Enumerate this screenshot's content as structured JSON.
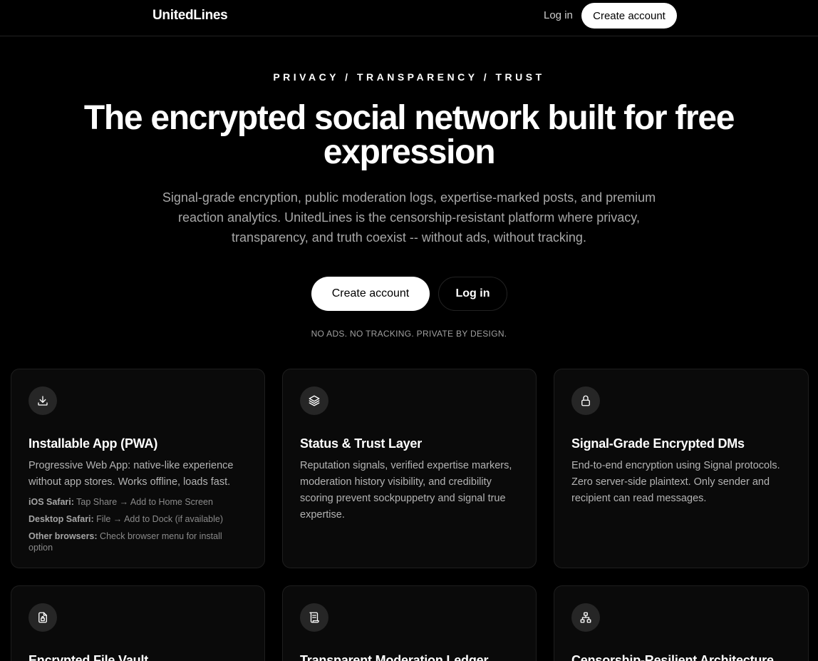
{
  "nav": {
    "brand": "UnitedLines",
    "login_label": "Log in",
    "create_label": "Create account"
  },
  "hero": {
    "eyebrow": "PRIVACY / TRANSPARENCY / TRUST",
    "title": "The encrypted social network built for free expression",
    "subtitle": "Signal-grade encryption, public moderation logs, expertise-marked posts, and premium reaction analytics. UnitedLines is the censorship-resistant platform where privacy, transparency, and truth coexist -- without ads, without tracking.",
    "create_label": "Create account",
    "login_label": "Log in",
    "tagline": "NO ADS. NO TRACKING. PRIVATE BY DESIGN."
  },
  "features": [
    {
      "icon": "download-icon",
      "title": "Installable App (PWA)",
      "desc": "Progressive Web App: native-like experience without app stores. Works offline, loads fast.",
      "install": [
        {
          "label": "iOS Safari:",
          "text": " Tap Share → Add to Home Screen"
        },
        {
          "label": "Desktop Safari:",
          "text": " File → Add to Dock (if available)"
        },
        {
          "label": "Other browsers:",
          "text": " Check browser menu for install option"
        }
      ]
    },
    {
      "icon": "layers-icon",
      "title": "Status & Trust Layer",
      "desc": "Reputation signals, verified expertise markers, moderation history visibility, and credibility scoring prevent sockpuppetry and signal true expertise."
    },
    {
      "icon": "lock-icon",
      "title": "Signal-Grade Encrypted DMs",
      "desc": "End-to-end encryption using Signal protocols. Zero server-side plaintext. Only sender and recipient can read messages."
    },
    {
      "icon": "file-lock-icon",
      "title": "Encrypted File Vault",
      "desc": ""
    },
    {
      "icon": "scroll-icon",
      "title": "Transparent Moderation Ledger",
      "desc": ""
    },
    {
      "icon": "network-icon",
      "title": "Censorship-Resilient Architecture",
      "desc": ""
    }
  ]
}
